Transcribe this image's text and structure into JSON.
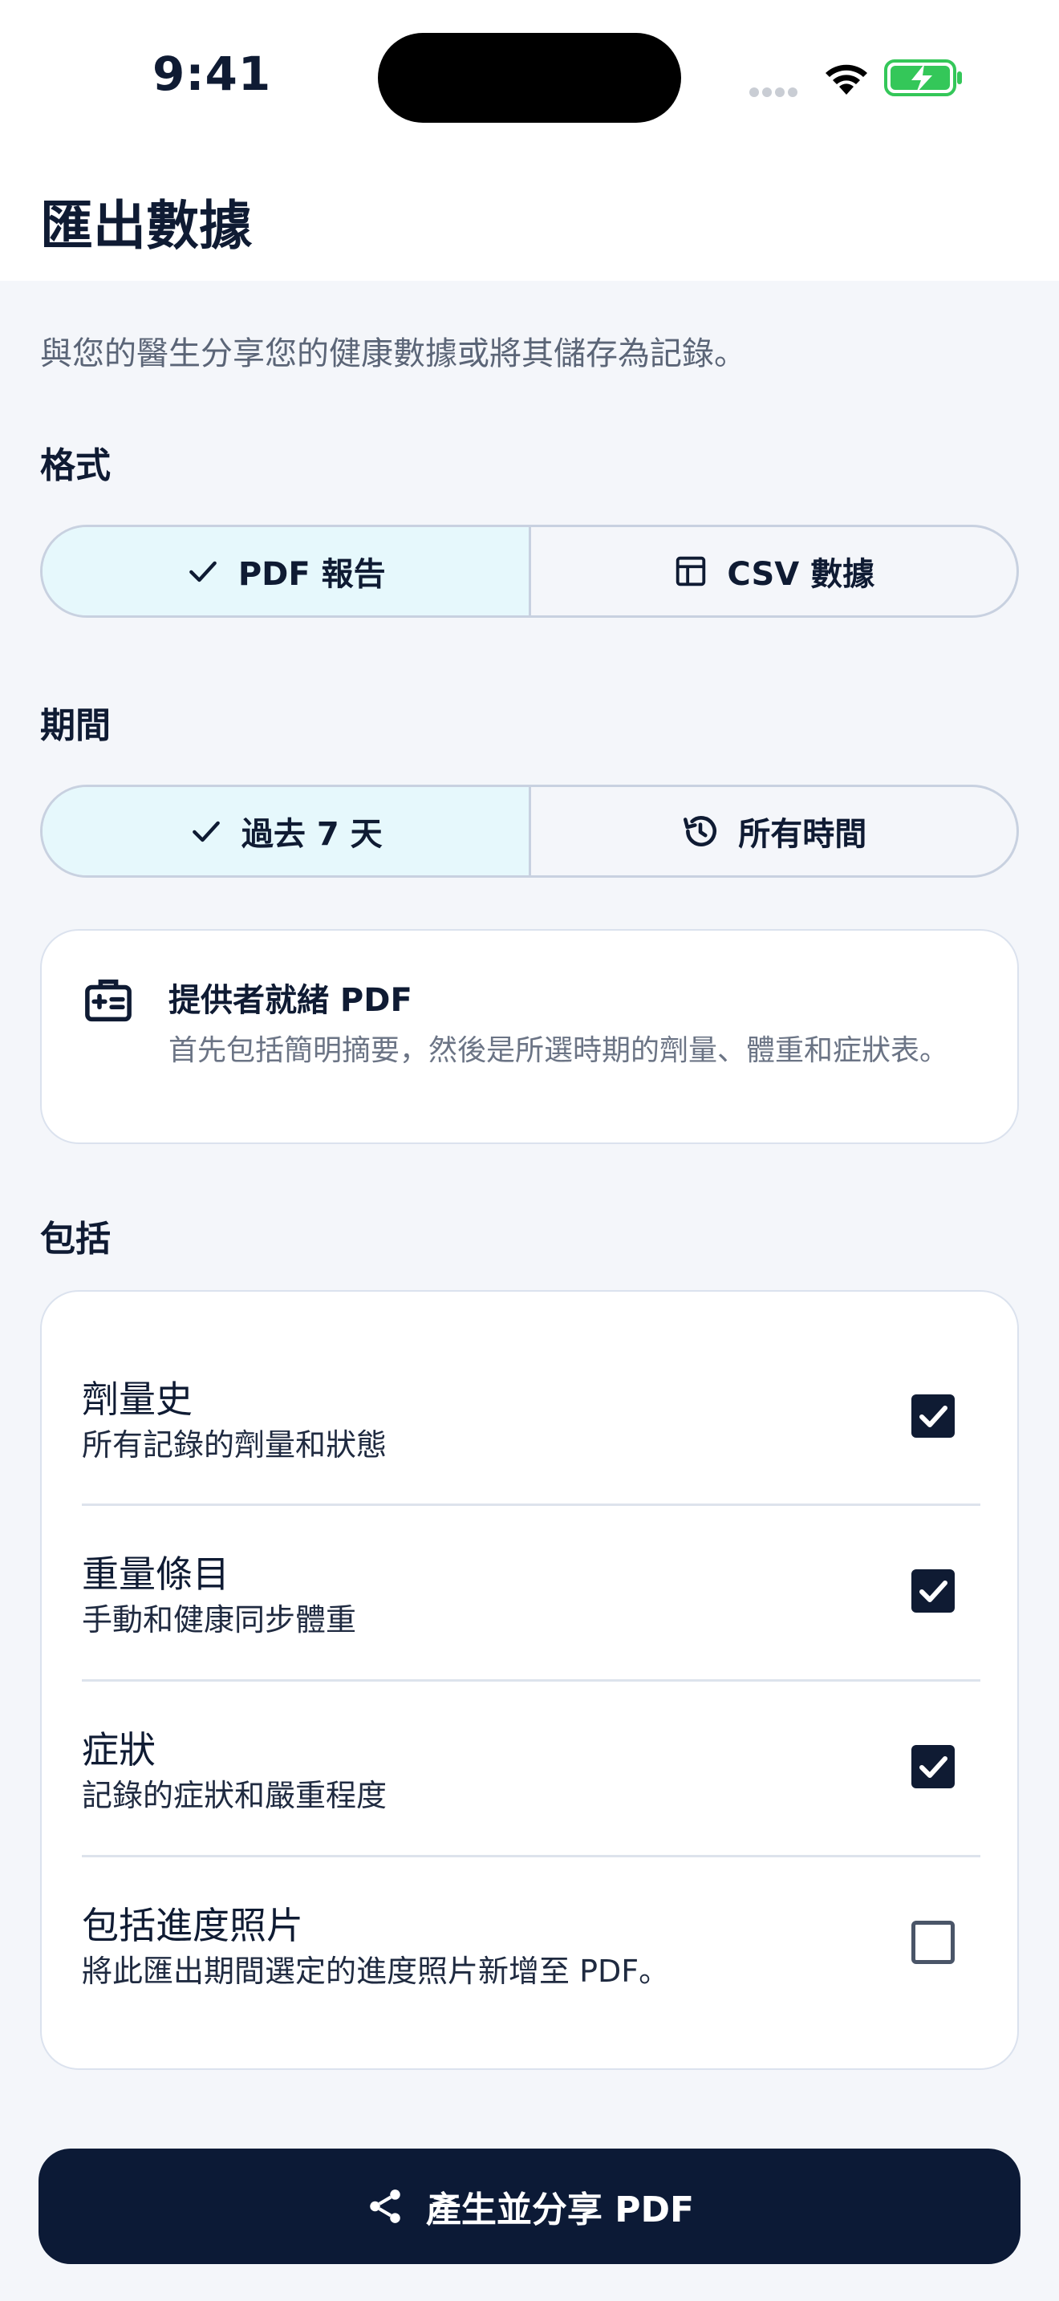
{
  "status_bar": {
    "time": "9:41"
  },
  "header": {
    "title": "匯出數據"
  },
  "intro": "與您的醫生分享您的健康數據或將其儲存為記錄。",
  "format": {
    "label": "格式",
    "options": [
      {
        "label": "PDF 報告",
        "selected": true,
        "icon": "check-icon"
      },
      {
        "label": "CSV 數據",
        "selected": false,
        "icon": "table-icon"
      }
    ]
  },
  "period": {
    "label": "期間",
    "options": [
      {
        "label": "過去 7 天",
        "selected": true,
        "icon": "check-icon"
      },
      {
        "label": "所有時間",
        "selected": false,
        "icon": "history-icon"
      }
    ]
  },
  "info_card": {
    "icon": "medical-id-icon",
    "title": "提供者就緒 PDF",
    "description": "首先包括簡明摘要，然後是所選時期的劑量、體重和症狀表。"
  },
  "include": {
    "label": "包括",
    "items": [
      {
        "title": "劑量史",
        "subtitle": "所有記錄的劑量和狀態",
        "checked": true
      },
      {
        "title": "重量條目",
        "subtitle": "手動和健康同步體重",
        "checked": true
      },
      {
        "title": "症狀",
        "subtitle": "記錄的症狀和嚴重程度",
        "checked": true
      },
      {
        "title": "包括進度照片",
        "subtitle": "將此匯出期間選定的進度照片新增至 PDF。",
        "checked": false
      }
    ]
  },
  "primary_action": {
    "label": "產生並分享 PDF",
    "icon": "share-icon"
  },
  "colors": {
    "primary": "#0c1a36",
    "selected_segment": "#e6f8fc",
    "battery": "#34c759"
  }
}
